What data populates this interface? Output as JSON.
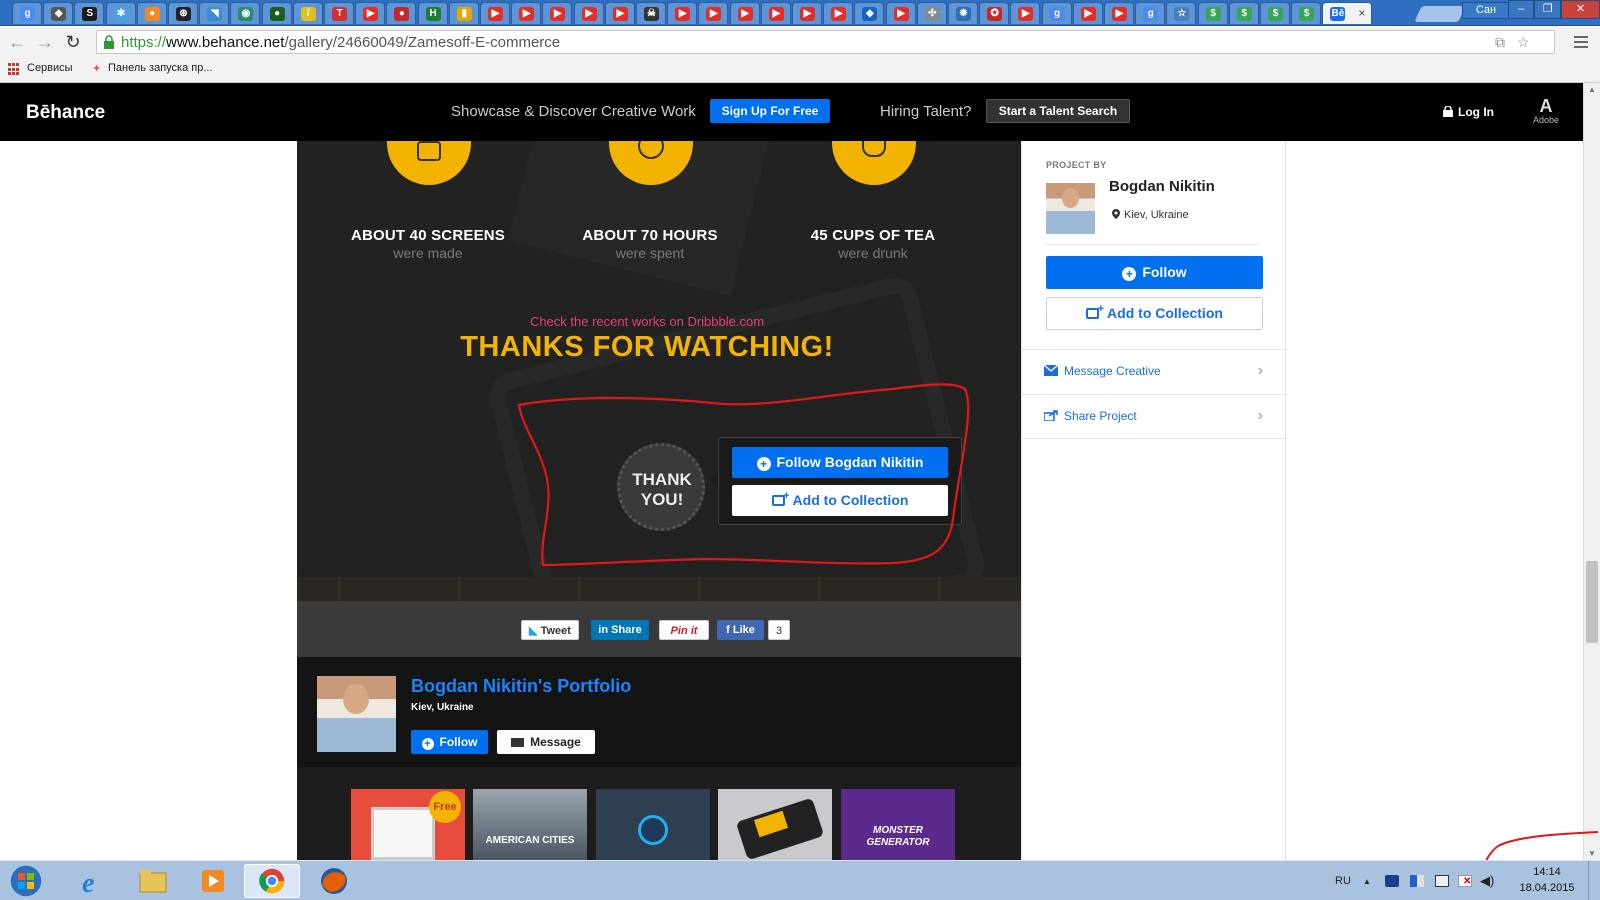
{
  "browser": {
    "tabs": [
      {
        "icon": "google-icon",
        "color": "#4a8af4",
        "glyph": "g"
      },
      {
        "icon": "gamepad-icon",
        "color": "#555555",
        "glyph": "◆"
      },
      {
        "icon": "scribd-icon",
        "color": "#1a1a1a",
        "glyph": "S"
      },
      {
        "icon": "snowflake-icon",
        "color": "#4aa0e0",
        "glyph": "✻"
      },
      {
        "icon": "paw-icon",
        "color": "#f08a24",
        "glyph": "●"
      },
      {
        "icon": "film-reel-icon",
        "color": "#222222",
        "glyph": "⊛"
      },
      {
        "icon": "bird-icon",
        "color": "#3b8bd4",
        "glyph": "◥"
      },
      {
        "icon": "planet-icon",
        "color": "#2a8c6e",
        "glyph": "◉"
      },
      {
        "icon": "drop-icon",
        "color": "#1b5e20",
        "glyph": "●"
      },
      {
        "icon": "pen-icon",
        "color": "#e0c020",
        "glyph": "/"
      },
      {
        "icon": "t-icon",
        "color": "#d32f2f",
        "glyph": "T"
      },
      {
        "icon": "youtube-icon",
        "color": "#e52d27",
        "glyph": "▶"
      },
      {
        "icon": "record-icon",
        "color": "#c62828",
        "glyph": "●"
      },
      {
        "icon": "h-icon",
        "color": "#1e7e34",
        "glyph": "H"
      },
      {
        "icon": "chart-icon",
        "color": "#e6a800",
        "glyph": "▮"
      },
      {
        "icon": "youtube-icon",
        "color": "#e52d27",
        "glyph": "▶"
      },
      {
        "icon": "youtube-icon",
        "color": "#e52d27",
        "glyph": "▶"
      },
      {
        "icon": "youtube-icon",
        "color": "#e52d27",
        "glyph": "▶"
      },
      {
        "icon": "youtube-icon",
        "color": "#e52d27",
        "glyph": "▶"
      },
      {
        "icon": "youtube-icon",
        "color": "#e52d27",
        "glyph": "▶"
      },
      {
        "icon": "skull-icon",
        "color": "#333333",
        "glyph": "☠"
      },
      {
        "icon": "youtube-icon",
        "color": "#e52d27",
        "glyph": "▶"
      },
      {
        "icon": "youtube-icon",
        "color": "#e52d27",
        "glyph": "▶"
      },
      {
        "icon": "youtube-icon",
        "color": "#e52d27",
        "glyph": "▶"
      },
      {
        "icon": "youtube-icon",
        "color": "#e52d27",
        "glyph": "▶"
      },
      {
        "icon": "youtube-icon",
        "color": "#e52d27",
        "glyph": "▶"
      },
      {
        "icon": "youtube-icon",
        "color": "#e52d27",
        "glyph": "▶"
      },
      {
        "icon": "pin-drop-icon",
        "color": "#1565c0",
        "glyph": "◆"
      },
      {
        "icon": "youtube-icon",
        "color": "#e52d27",
        "glyph": "▶"
      },
      {
        "icon": "puzzle-icon",
        "color": "#7f8c8d",
        "glyph": "✣"
      },
      {
        "icon": "gear-icon",
        "color": "#2d6db5",
        "glyph": "✹"
      },
      {
        "icon": "emblem-icon",
        "color": "#c62828",
        "glyph": "✪"
      },
      {
        "icon": "youtube-icon",
        "color": "#e52d27",
        "glyph": "▶"
      },
      {
        "icon": "google-icon",
        "color": "#4a8af4",
        "glyph": "g"
      },
      {
        "icon": "youtube-icon",
        "color": "#e52d27",
        "glyph": "▶"
      },
      {
        "icon": "youtube-icon",
        "color": "#e52d27",
        "glyph": "▶"
      },
      {
        "icon": "google-icon",
        "color": "#4a8af4",
        "glyph": "g"
      },
      {
        "icon": "star-icon",
        "color": "#4a7ebd",
        "glyph": "☆"
      },
      {
        "icon": "dollar-icon",
        "color": "#3aa655",
        "glyph": "$"
      },
      {
        "icon": "dollar-icon",
        "color": "#3aa655",
        "glyph": "$"
      },
      {
        "icon": "dollar-icon",
        "color": "#3aa655",
        "glyph": "$"
      },
      {
        "icon": "dollar-icon",
        "color": "#3aa655",
        "glyph": "$"
      },
      {
        "icon": "behance-icon",
        "color": "#1769ff",
        "glyph": "Bē"
      }
    ],
    "active_tab_close": "×",
    "user_label": "Сан",
    "window_buttons": {
      "minimize": "–",
      "restore": "❐",
      "close": "✕"
    },
    "back": "←",
    "forward": "→",
    "reload": "↻",
    "url_scheme": "https://",
    "url_host": "www.behance.net",
    "url_path": "/gallery/24660049/Zamesoff-E-commerce",
    "bookmarks": {
      "apps": "Сервисы",
      "launcher": "Панель запуска пр..."
    }
  },
  "behance_nav": {
    "logo": "Bēhance",
    "tagline": "Showcase & Discover Creative Work",
    "signup": "Sign Up For Free",
    "hiring": "Hiring Talent?",
    "talent_search": "Start a Talent Search",
    "login": "Log In",
    "adobe_glyph": "A",
    "adobe": "Adobe"
  },
  "project": {
    "stats": [
      {
        "big": "ABOUT 40 SCREENS",
        "small": "were made"
      },
      {
        "big": "ABOUT 70 HOURS",
        "small": "were spent"
      },
      {
        "big": "45 CUPS OF TEA",
        "small": "were drunk"
      }
    ],
    "dribbble": "Check the recent works on Dribbble.com",
    "thanks_title": "THANKS FOR WATCHING!",
    "thank_you_badge": [
      "THANK",
      "YOU!"
    ],
    "popover": {
      "follow": "Follow Bogdan Nikitin",
      "collection": "Add to Collection"
    },
    "share": {
      "tweet": "Tweet",
      "linkedin": "Share",
      "pinterest": "Pin it",
      "like": "Like",
      "like_count": "3"
    },
    "portfolio": {
      "name": "Bogdan Nikitin's Portfolio",
      "location": "Kiev, Ukraine",
      "follow": "Follow",
      "message": "Message"
    },
    "thumbnails": [
      {
        "caption": "",
        "badge": "Free"
      },
      {
        "caption": "AMERICAN CITIES",
        "badge": ""
      },
      {
        "caption": "",
        "badge": ""
      },
      {
        "caption": "",
        "badge": ""
      },
      {
        "caption": "MONSTER GENERATOR",
        "badge": ""
      }
    ]
  },
  "sidebar": {
    "label": "PROJECT BY",
    "name": "Bogdan Nikitin",
    "location": "Kiev, Ukraine",
    "follow": "Follow",
    "collection": "Add to Collection",
    "message": "Message Creative",
    "share": "Share Project"
  },
  "taskbar": {
    "apps": [
      "internet-explorer",
      "file-explorer",
      "media-player",
      "chrome",
      "firefox"
    ],
    "lang": "RU",
    "time": "14:14",
    "date": "18.04.2015"
  },
  "colors": {
    "behance_blue": "#0070f0",
    "accent_yellow": "#f2b400",
    "annotation_red": "#e0181c"
  }
}
